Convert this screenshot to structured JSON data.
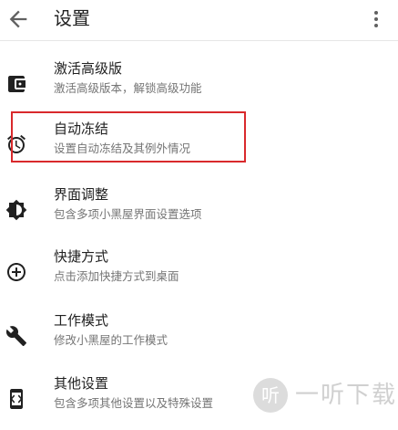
{
  "toolbar": {
    "title": "设置",
    "back_icon": "arrow-back-icon",
    "more_icon": "more-vert-icon"
  },
  "items": [
    {
      "title": "激活高级版",
      "subtitle": "激活高级版本，解锁高级功能",
      "icon": "wallet-icon"
    },
    {
      "title": "自动冻结",
      "subtitle": "设置自动冻结及其例外情况",
      "icon": "alarm-icon"
    },
    {
      "title": "界面调整",
      "subtitle": "包含多项小黑屋界面设置选项",
      "icon": "brightness-icon"
    },
    {
      "title": "快捷方式",
      "subtitle": "点击添加快捷方式到桌面",
      "icon": "add-circle-icon"
    },
    {
      "title": "工作模式",
      "subtitle": "修改小黑屋的工作模式",
      "icon": "wrench-icon"
    },
    {
      "title": "其他设置",
      "subtitle": "包含多项其他设置以及特殊设置",
      "icon": "settings-ethernet-icon"
    }
  ],
  "watermark": {
    "logo_char": "听",
    "text": "一听下载"
  },
  "colors": {
    "highlight": "#d9292c",
    "icon": "#212121",
    "subtitle": "#757575"
  }
}
